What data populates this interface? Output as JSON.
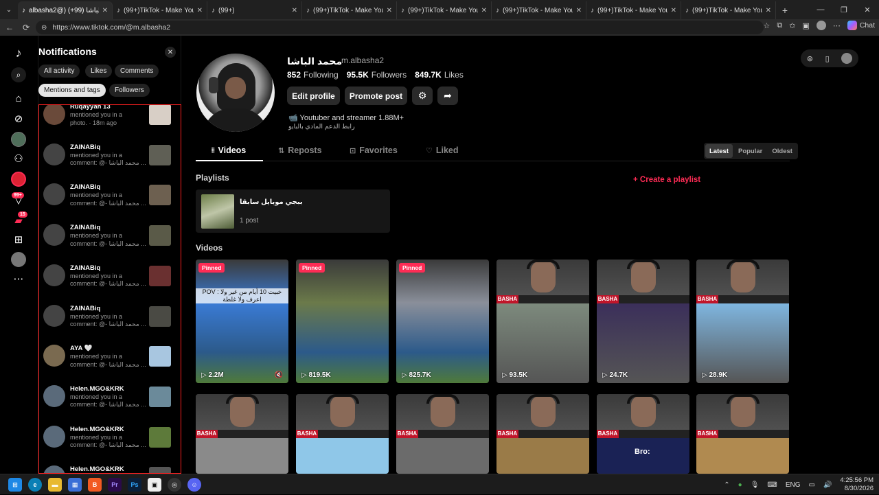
{
  "browser": {
    "tabs": [
      {
        "label": "albasha2@) محمد الباشا (99+)",
        "active": true
      },
      {
        "label": "(99+)TikTok - Make Your Day",
        "active": false
      },
      {
        "label": "(99+)",
        "active": false
      },
      {
        "label": "(99+)TikTok - Make Your Day",
        "active": false
      },
      {
        "label": "(99+)TikTok - Make Your Day",
        "active": false
      },
      {
        "label": "(99+)TikTok - Make Your Day",
        "active": false
      },
      {
        "label": "(99+)TikTok - Make Your Day",
        "active": false
      },
      {
        "label": "(99+)TikTok - Make Your Da",
        "active": false
      }
    ],
    "url": "https://www.tiktok.com/@m.albasha2",
    "chat_label": "Chat"
  },
  "rail": {
    "badge_inbox": "99+",
    "badge_messages": "15"
  },
  "notifications": {
    "title": "Notifications",
    "filters": [
      "All activity",
      "Likes",
      "Comments",
      "Mentions and tags",
      "Followers"
    ],
    "active_filter": "Mentions and tags",
    "items": [
      {
        "name": "Ruqayyah 13",
        "line1": "mentioned you in a",
        "line2": "photo. · 18m ago"
      },
      {
        "name": "ZAINABiq",
        "line1": "mentioned you in a",
        "line2": "comment: @- محمد الباشا ..."
      },
      {
        "name": "ZAINABiq",
        "line1": "mentioned you in a",
        "line2": "comment: @- محمد الباشا ..."
      },
      {
        "name": "ZAINABiq",
        "line1": "mentioned you in a",
        "line2": "comment: @- محمد الباشا ..."
      },
      {
        "name": "ZAINABiq",
        "line1": "mentioned you in a",
        "line2": "comment: @- محمد الباشا ..."
      },
      {
        "name": "ZAINABiq",
        "line1": "mentioned you in a",
        "line2": "comment: @- محمد الباشا ..."
      },
      {
        "name": "AYA 🤍",
        "line1": "mentioned you in a",
        "line2": "comment: @- محمد الباشا ..."
      },
      {
        "name": "Helen.MGO&KRK",
        "line1": "mentioned you in a",
        "line2": "comment: @- محمد الباشا ..."
      },
      {
        "name": "Helen.MGO&KRK",
        "line1": "mentioned you in a",
        "line2": "comment: @- محمد الباشا ..."
      },
      {
        "name": "Helen.MGO&KRK",
        "line1": "",
        "line2": ""
      }
    ]
  },
  "profile": {
    "display_name": "محمد الباشا",
    "username": "m.albasha2",
    "following_count": "852",
    "following_label": "Following",
    "followers_count": "95.5K",
    "followers_label": "Followers",
    "likes_count": "849.7K",
    "likes_label": "Likes",
    "edit_label": "Edit profile",
    "promote_label": "Promote post",
    "bio_line1": "📹 Youtuber and streamer 1.88M+",
    "bio_line2": "رابط الدعم المادي بالبايو"
  },
  "content_tabs": [
    "Videos",
    "Reposts",
    "Favorites",
    "Liked"
  ],
  "sort": {
    "options": [
      "Latest",
      "Popular",
      "Oldest"
    ],
    "active": "Latest"
  },
  "playlists": {
    "section_label": "Playlists",
    "create_label": "+ Create a playlist",
    "items": [
      {
        "title": "ببجي موبايل سابقا",
        "count": "1 post"
      }
    ]
  },
  "videos": {
    "section_label": "Videos",
    "row1": [
      {
        "pinned": "Pinned",
        "views": "▷ 2.2M",
        "overlay": "POV : خبيت 10 أيام من غير ولا اعرف ولا غلطة",
        "accent": "#3a7bd5"
      },
      {
        "pinned": "Pinned",
        "views": "▷ 819.5K",
        "overlay": "",
        "accent": "#6b7a4a"
      },
      {
        "pinned": "Pinned",
        "views": "▷ 825.7K",
        "overlay": "",
        "accent": "#8a8f9a"
      },
      {
        "pinned": "",
        "views": "▷ 93.5K",
        "overlay": "",
        "accent": "#7d8a7d"
      },
      {
        "pinned": "",
        "views": "▷ 24.7K",
        "overlay": "",
        "accent": "#3b2f5a"
      },
      {
        "pinned": "",
        "views": "▷ 28.9K",
        "overlay": "",
        "accent": "#7fb6e0"
      }
    ],
    "row2_accents": [
      "#8a8a8a",
      "#8fc7e8",
      "#6b6b6b",
      "#9a7b48",
      "#1a2255",
      "#b08a50"
    ],
    "brand": "BASHA",
    "row2_overlay": "Bro:"
  },
  "taskbar": {
    "lang": "ENG",
    "time": "4:25:56 PM",
    "date": "8/30/2026"
  }
}
